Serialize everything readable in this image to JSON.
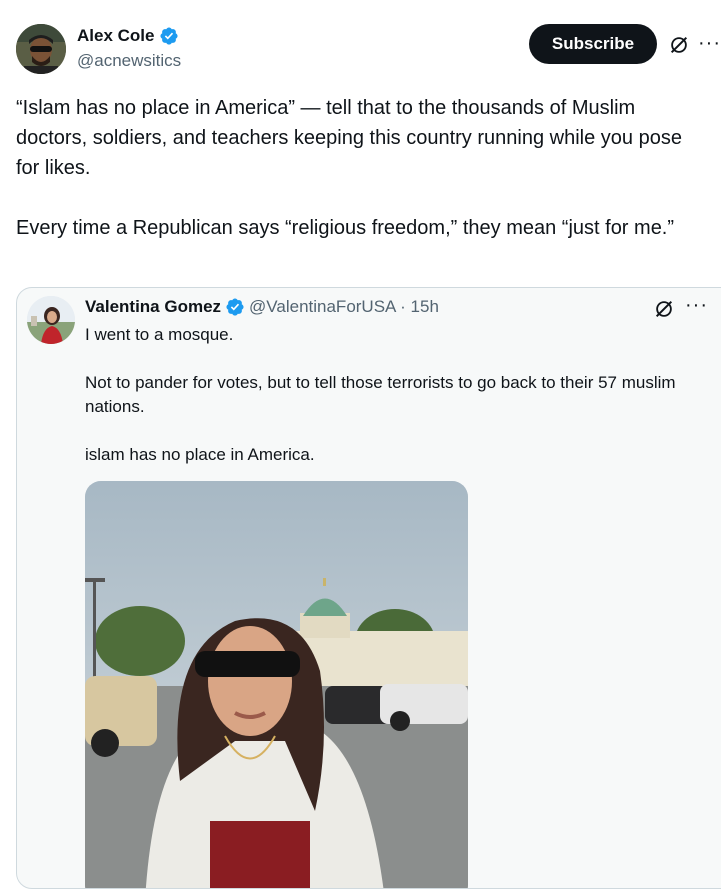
{
  "author": {
    "name": "Alex Cole",
    "handle": "@acnewsitics"
  },
  "actions": {
    "subscribe_label": "Subscribe",
    "more_label": "···"
  },
  "post": {
    "text": "“Islam has no place in America” — tell that to the thousands of Muslim doctors, soldiers, and teachers keeping this country running while you pose for likes.\n\nEvery time a Republican says “religious freedom,” they mean “just for me.”"
  },
  "quoted": {
    "name": "Valentina Gomez",
    "meta": "@ValentinaForUSA · 15h",
    "text": "I went to a mosque.\n\nNot to pander for votes, but to tell those terrorists to go back to their 57 muslim nations.\n\nislam has no place in America.",
    "more_label": "···"
  },
  "colors": {
    "verified": "#1d9bf0",
    "subscribe_bg": "#0f1419"
  }
}
